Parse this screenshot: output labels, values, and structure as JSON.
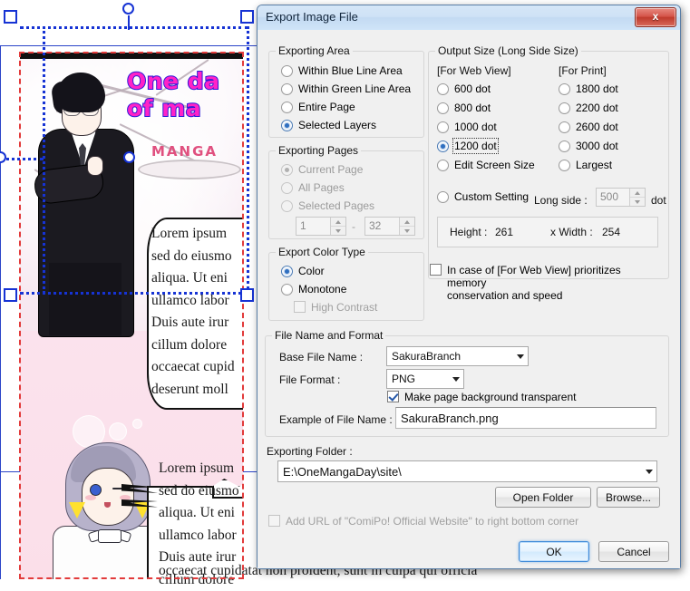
{
  "dialog": {
    "title": "Export Image File",
    "close_label": "x",
    "exporting_area": {
      "legend": "Exporting Area",
      "options": [
        {
          "label": "Within Blue Line Area",
          "selected": false,
          "disabled": false
        },
        {
          "label": "Within Green Line Area",
          "selected": false,
          "disabled": false
        },
        {
          "label": "Entire Page",
          "selected": false,
          "disabled": false
        },
        {
          "label": "Selected Layers",
          "selected": true,
          "disabled": false
        }
      ]
    },
    "exporting_pages": {
      "legend": "Exporting Pages",
      "options": [
        {
          "label": "Current Page",
          "selected": true,
          "disabled": true
        },
        {
          "label": "All Pages",
          "selected": false,
          "disabled": true
        },
        {
          "label": "Selected Pages",
          "selected": false,
          "disabled": true
        }
      ],
      "range_from": "1",
      "range_sep": "-",
      "range_to": "32"
    },
    "export_color_type": {
      "legend": "Export Color Type",
      "options": [
        {
          "label": "Color",
          "selected": true,
          "disabled": false
        },
        {
          "label": "Monotone",
          "selected": false,
          "disabled": false
        }
      ],
      "high_contrast": {
        "label": "High Contrast",
        "checked": false,
        "disabled": true
      }
    },
    "output_size": {
      "legend": "Output Size (Long Side Size)",
      "web_header": "[For Web View]",
      "print_header": "[For Print]",
      "web_options": [
        {
          "label": "600 dot",
          "selected": false
        },
        {
          "label": "800 dot",
          "selected": false
        },
        {
          "label": "1000 dot",
          "selected": false
        },
        {
          "label": "1200 dot",
          "selected": true,
          "focused": true
        },
        {
          "label": "Edit Screen Size",
          "selected": false
        }
      ],
      "print_options": [
        {
          "label": "1800 dot",
          "selected": false
        },
        {
          "label": "2200 dot",
          "selected": false
        },
        {
          "label": "2600 dot",
          "selected": false
        },
        {
          "label": "3000 dot",
          "selected": false
        },
        {
          "label": "Largest",
          "selected": false
        }
      ],
      "custom_setting": {
        "label": "Custom Setting",
        "selected": false
      },
      "long_side_label": "Long side :",
      "long_side_value": "500",
      "dot_unit": "dot",
      "height_label": "Height :",
      "height_value": "261",
      "width_label": "x Width :",
      "width_value": "254",
      "memory_checkbox": {
        "line1": "In case of [For Web View] prioritizes memory",
        "line2": "conservation and speed",
        "checked": false
      }
    },
    "file_name_and_format": {
      "legend": "File Name and Format",
      "base_file_name_label": "Base File Name :",
      "base_file_name_value": "SakuraBranch",
      "file_format_label": "File Format :",
      "file_format_value": "PNG",
      "transparent_checkbox": {
        "label": "Make page background transparent",
        "checked": true
      },
      "example_label": "Example of File Name :",
      "example_value": "SakuraBranch.png"
    },
    "exporting_folder": {
      "label": "Exporting Folder :",
      "value": "E:\\OneMangaDay\\site\\",
      "open_folder_button": "Open Folder",
      "browse_button": "Browse..."
    },
    "add_url_checkbox": {
      "label": "Add URL of \"ComiPo! Official Website\" to right bottom corner",
      "checked": false,
      "disabled": true
    },
    "ok_button": "OK",
    "cancel_button": "Cancel"
  },
  "canvas": {
    "title_line1": "One da",
    "title_line2": "of ma",
    "manga_word": "MANGA",
    "balloon_top_text": "Lorem ipsum\nsed do eiusmo\naliqua. Ut eni\nullamco labor\nDuis aute irur\ncillum dolore\noccaecat cupid\ndeserunt moll",
    "balloon_bottom_text": "Lorem ipsum\nsed do eiusmo\naliqua. Ut eni\nullamco labor\nDuis aute irur\ncillum dolore",
    "bottom_overflow_text": "occaecat cupidatat non proident, sunt in culpa qui officia"
  },
  "colors": {
    "selection": "#1633d4",
    "page_border": "#e23b3b",
    "title_pink": "#ff22c8",
    "title_outline": "#2b1bd8",
    "accent_blue": "#3f8ad8"
  }
}
